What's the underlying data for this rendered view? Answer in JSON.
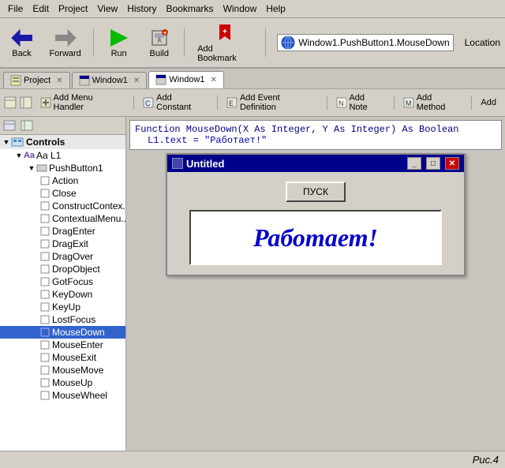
{
  "menubar": {
    "items": [
      "File",
      "Edit",
      "Project",
      "View",
      "History",
      "Bookmarks",
      "Window",
      "Help"
    ]
  },
  "toolbar": {
    "back_label": "Back",
    "forward_label": "Forward",
    "run_label": "Run",
    "build_label": "Build",
    "bookmark_label": "Add Bookmark",
    "location_text": "Window1.PushButton1.MouseDown",
    "location_label": "Location"
  },
  "tabs": {
    "items": [
      {
        "label": "Project",
        "active": false
      },
      {
        "label": "Window1",
        "active": false
      },
      {
        "label": "Window1",
        "active": true
      }
    ]
  },
  "toolbar2": {
    "buttons": [
      "Add Menu Handler",
      "Add Constant",
      "Add Event Definition",
      "Add Note",
      "Add Method",
      "Add"
    ]
  },
  "code": {
    "hint": "L1.text = \"Работает!\"",
    "function_sig": "Function MouseDown(X As Integer, Y As Integer) As Boolean"
  },
  "tree": {
    "section_label": "Controls",
    "sub_label": "Aa L1",
    "node_label": "PushButton1",
    "items": [
      "Action",
      "Close",
      "ConstructContex...",
      "ContextualMenu...",
      "DragEnter",
      "DragExit",
      "DragOver",
      "DropObject",
      "GotFocus",
      "KeyDown",
      "KeyUp",
      "LostFocus",
      "MouseDown",
      "MouseEnter",
      "MouseExit",
      "MouseMove",
      "MouseUp",
      "MouseWheel"
    ],
    "selected_item": "MouseDown"
  },
  "sim_window": {
    "title": "Untitled",
    "button_label": "ПУСК",
    "label_text": "Работает!",
    "min_btn": "_",
    "max_btn": "□",
    "close_btn": "✕"
  },
  "caption": {
    "text": "Рис.4"
  }
}
